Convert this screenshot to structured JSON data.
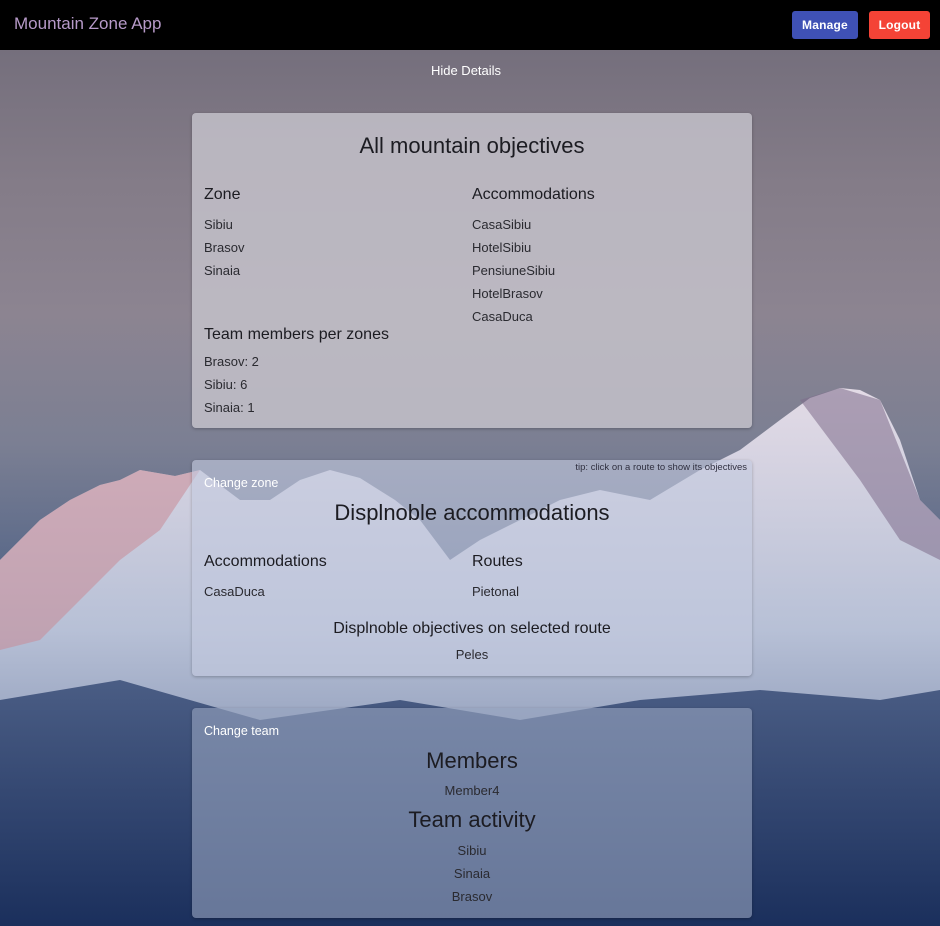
{
  "app": {
    "title": "Mountain Zone App"
  },
  "header": {
    "manage_label": "Manage",
    "logout_label": "Logout"
  },
  "colors": {
    "navbar": "#000000",
    "manage": "#3f51b5",
    "logout": "#f44336",
    "title": "#b79ac9"
  },
  "toggle": {
    "label": "Hide Details"
  },
  "objectives": {
    "title": "All mountain objectives",
    "zone": {
      "heading": "Zone",
      "items": [
        "Sibiu",
        "Brasov",
        "Sinaia"
      ]
    },
    "accommodations": {
      "heading": "Accommodations",
      "items": [
        "CasaSibiu",
        "HotelSibiu",
        "PensiuneSibiu",
        "HotelBrasov",
        "CasaDuca"
      ]
    },
    "team_members": {
      "heading": "Team members per zones",
      "items": [
        "Brasov: 2",
        "Sibiu: 6",
        "Sinaia: 1"
      ]
    }
  },
  "zone_panel": {
    "change_label": "Change zone",
    "tip": "tip: click on a route to show its objectives",
    "title": "Displnoble accommodations",
    "accommodations": {
      "heading": "Accommodations",
      "items": [
        "CasaDuca"
      ]
    },
    "routes": {
      "heading": "Routes",
      "items": [
        "Pietonal"
      ]
    },
    "objectives": {
      "heading": "Displnoble objectives on selected route",
      "items": [
        "Peles"
      ]
    }
  },
  "team_panel": {
    "change_label": "Change team",
    "members": {
      "heading": "Members",
      "items": [
        "Member4"
      ]
    },
    "activity": {
      "heading": "Team activity",
      "items": [
        "Sibiu",
        "Sinaia",
        "Brasov"
      ]
    }
  }
}
